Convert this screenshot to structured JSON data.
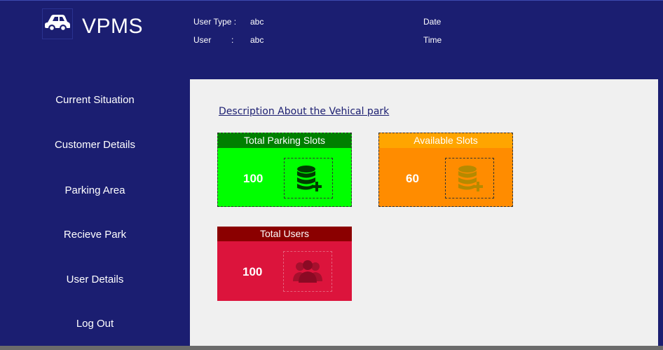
{
  "header": {
    "app_title": "VPMS",
    "user_type_label": "User Type :",
    "user_type_value": "abc",
    "user_label": "User",
    "user_colon": ":",
    "user_value": "abc",
    "date_label": "Date",
    "time_label": "Time",
    "logo_icon": "car-icon"
  },
  "sidebar": {
    "items": [
      {
        "label": "Current Situation"
      },
      {
        "label": "Customer Details"
      },
      {
        "label": "Parking Area"
      },
      {
        "label": "Recieve Park"
      },
      {
        "label": "User Details"
      },
      {
        "label": "Log Out"
      }
    ]
  },
  "main": {
    "description_link": "Description About the Vehical park",
    "cards": [
      {
        "title": "Total Parking Slots",
        "value": "100",
        "icon": "database-add-icon",
        "color": "#00ff00"
      },
      {
        "title": "Available Slots",
        "value": "60",
        "icon": "database-add-icon",
        "color": "#ff8c00"
      },
      {
        "title": "Total Users",
        "value": "100",
        "icon": "users-icon",
        "color": "#dc143c"
      }
    ]
  }
}
